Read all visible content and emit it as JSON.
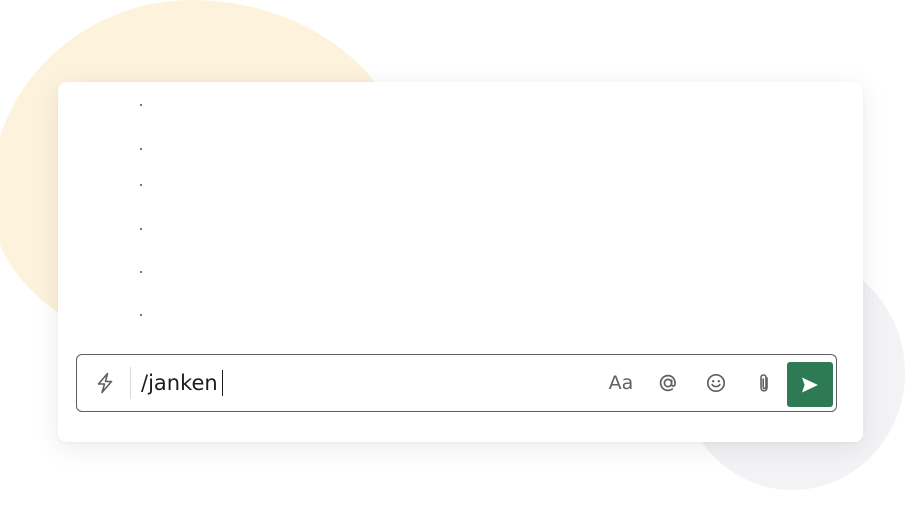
{
  "composer": {
    "input_value": "/janken",
    "format_label": "Aa",
    "icons": {
      "shortcuts": "lightning-bolt-icon",
      "mention": "at-sign-icon",
      "emoji": "smiley-face-icon",
      "attach": "paperclip-icon",
      "send": "paper-plane-icon"
    }
  },
  "colors": {
    "send_button": "#2d7a55",
    "background_blob_yellow": "#fdf3dd",
    "background_blob_grey": "#f3f3f5",
    "composer_border": "#5e5e5e"
  }
}
